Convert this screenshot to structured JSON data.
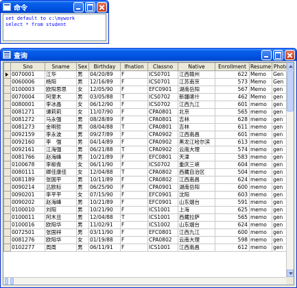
{
  "command_window": {
    "title": "命令",
    "lines": [
      "set default to c:\\mywork",
      "select * from student"
    ]
  },
  "browse_window": {
    "title": "查询",
    "columns": [
      "Sno",
      "Sname",
      "Sex",
      "Birthday",
      "Ifnation",
      "Classno",
      "Native",
      "Enrollment",
      "Resume",
      "Photo"
    ],
    "rows": [
      [
        "0070001",
        "江华",
        "男",
        "04/20/89",
        "F",
        "ICS0701",
        "江西赣州",
        "622",
        "Memo",
        "Gen"
      ],
      [
        "0060006",
        "杨阳",
        "男",
        "12/16/89",
        "F",
        "ICS0701",
        "江苏南京",
        "573",
        "Memo",
        "Gen"
      ],
      [
        "0100003",
        "欧阳思思",
        "女",
        "12/05/90",
        "F",
        "EFC0901",
        "湖南岳阳",
        "567",
        "Memo",
        "gen"
      ],
      [
        "0070004",
        "阿里木",
        "男",
        "03/05/88",
        "T",
        "ICS0702",
        "新疆喀什",
        "462",
        "Memo",
        "gen"
      ],
      [
        "0080001",
        "李冰晶",
        "女",
        "06/12/90",
        "F",
        "ICS0702",
        "江西九江",
        "601",
        "memo",
        "gen"
      ],
      [
        "0081271",
        "谭莉莉",
        "女",
        "11/07/90",
        "F",
        "CPA0801",
        "北京",
        "565",
        "memo",
        "gen"
      ],
      [
        "0081272",
        "马永强",
        "男",
        "08/28/89",
        "F",
        "CPA0801",
        "吉林",
        "628",
        "memo",
        "gen"
      ],
      [
        "0081273",
        "金明哲",
        "男",
        "08/04/88",
        "T",
        "CPA0801",
        "吉林",
        "611",
        "memo",
        "gen"
      ],
      [
        "0092159",
        "李永波",
        "男",
        "09/27/89",
        "F",
        "CPA0902",
        "江西南昌",
        "601",
        "memo",
        "gen"
      ],
      [
        "0092160",
        "李　强",
        "男",
        "04/14/89",
        "F",
        "CPA0902",
        "黑龙江哈尔滨",
        "613",
        "memo",
        "gen"
      ],
      [
        "0092161",
        "江海强",
        "男",
        "06/21/88",
        "T",
        "CPA0902",
        "云南大理",
        "574",
        "memo",
        "gen"
      ],
      [
        "0081766",
        "赵海峰",
        "男",
        "10/21/89",
        "F",
        "EFC0801",
        "天津",
        "583",
        "memo",
        "gen"
      ],
      [
        "0100678",
        "李柳青",
        "女",
        "06/11/90",
        "F",
        "ICS0702",
        "重庆三峡",
        "604",
        "memo",
        "gen"
      ],
      [
        "0080111",
        "卿佳康佳",
        "女",
        "12/04/88",
        "T",
        "CPA0802",
        "西藏自治区",
        "504",
        "memo",
        "gen"
      ],
      [
        "0081189",
        "张国平",
        "男",
        "10/11/89",
        "F",
        "CPA0802",
        "江西南昌",
        "624",
        "memo",
        "gen"
      ],
      [
        "0090214",
        "吕欧标",
        "男",
        "06/25/90",
        "F",
        "CPA0901",
        "湖南岳阳",
        "600",
        "memo",
        "gen"
      ],
      [
        "0090201",
        "李平平",
        "女",
        "07/15/90",
        "F",
        "EFC0901",
        "沈阳",
        "603",
        "memo",
        "gen"
      ],
      [
        "0090202",
        "赵海峰",
        "男",
        "10/21/89",
        "F",
        "EFC0901",
        "山东烟台",
        "591",
        "memo",
        "gen"
      ],
      [
        "0100010",
        "刘阳",
        "男",
        "10/21/90",
        "F",
        "ICS1001",
        "上海",
        "625",
        "memo",
        "gen"
      ],
      [
        "0100011",
        "阿木旦",
        "男",
        "12/04/88",
        "T",
        "ICS1001",
        "西藏拉萨",
        "565",
        "memo",
        "gen"
      ],
      [
        "0100016",
        "欧阳华",
        "男",
        "11/02/91",
        "F",
        "ICS1002",
        "山东烟台",
        "624",
        "memo",
        "gen"
      ],
      [
        "0072501",
        "张国祥",
        "男",
        "03/11/90",
        "F",
        "EFC0801",
        "江西九江",
        "600",
        "memo",
        "gen"
      ],
      [
        "0081276",
        "欧阳华",
        "女",
        "01/19/88",
        "F",
        "CPA0802",
        "云南大理",
        "598",
        "memo",
        "gen"
      ],
      [
        "0102277",
        "周周",
        "男",
        "06/11/91",
        "F",
        "ICS1001",
        "江西南昌",
        "612",
        "memo",
        "gen"
      ]
    ]
  }
}
